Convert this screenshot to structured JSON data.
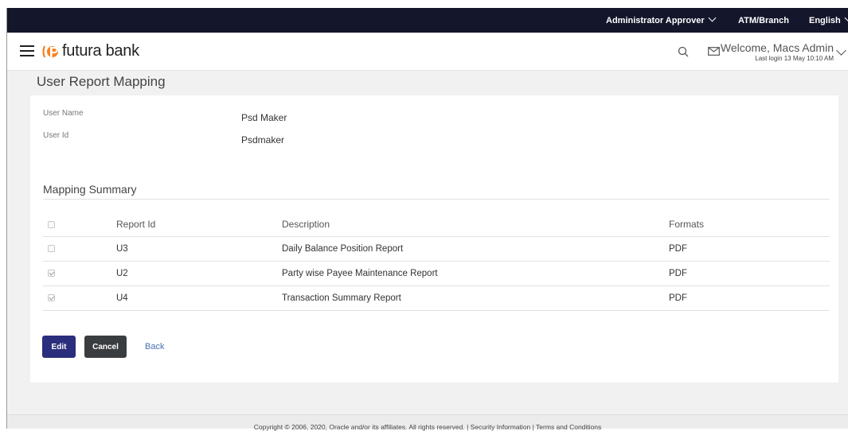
{
  "topbar": {
    "role": "Administrator Approver",
    "branch": "ATM/Branch",
    "language": "English"
  },
  "header": {
    "logo_text": "futura bank",
    "welcome": "Welcome, Macs Admin",
    "last_login": "Last login 13 May 10:10 AM",
    "icons": [
      "menu-icon",
      "search-icon",
      "mail-icon",
      "chevron-down-icon"
    ]
  },
  "page": {
    "title": "User Report Mapping",
    "fields": [
      {
        "label": "User Name",
        "value": "Psd Maker"
      },
      {
        "label": "User Id",
        "value": "Psdmaker"
      }
    ],
    "section_title": "Mapping Summary",
    "table": {
      "headers": [
        "Report Id",
        "Description",
        "Formats"
      ],
      "header_checked": false,
      "rows": [
        {
          "checked": false,
          "id": "U3",
          "description": "Daily Balance Position Report",
          "format": "PDF"
        },
        {
          "checked": true,
          "id": "U2",
          "description": "Party wise Payee Maintenance Report",
          "format": "PDF"
        },
        {
          "checked": true,
          "id": "U4",
          "description": "Transaction Summary Report",
          "format": "PDF"
        }
      ]
    },
    "buttons": {
      "edit": "Edit",
      "cancel": "Cancel",
      "back": "Back"
    }
  },
  "footer": {
    "text": "Copyright © 2006, 2020, Oracle and/or its affiliates. All rights reserved. | Security Information | Terms and Conditions"
  },
  "colors": {
    "topbar": "#14162b",
    "primary_button": "#2a2e7c",
    "secondary_button": "#3a3d40",
    "link": "#4a6fb1",
    "logo_accent": "#f58220"
  }
}
